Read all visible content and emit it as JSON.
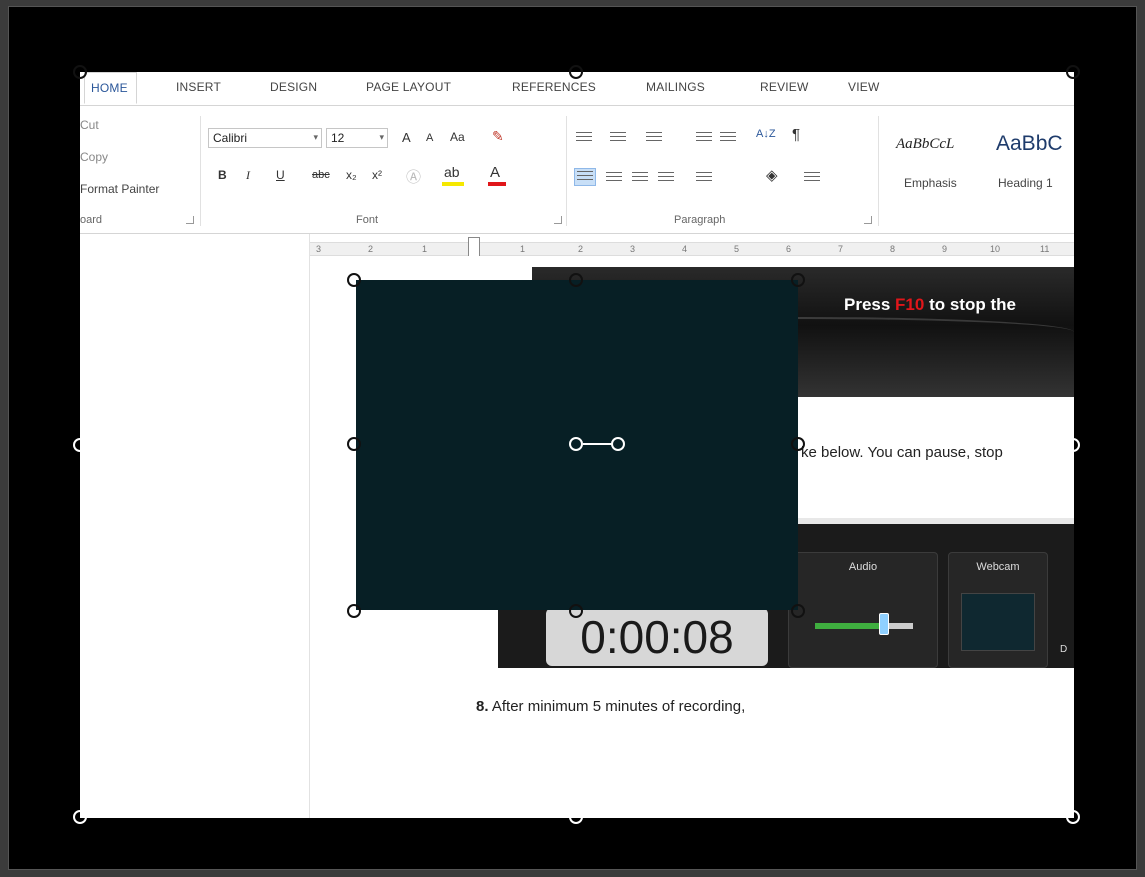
{
  "ribbon": {
    "tabs": [
      "HOME",
      "INSERT",
      "DESIGN",
      "PAGE LAYOUT",
      "REFERENCES",
      "MAILINGS",
      "REVIEW",
      "VIEW"
    ],
    "clipboard": {
      "cut": "Cut",
      "copy": "Copy",
      "format_painter": "Format Painter",
      "group_label": "oard"
    },
    "font": {
      "family": "Calibri",
      "size": "12",
      "group_label": "Font",
      "grow": "A",
      "shrink": "A",
      "case": "Aa",
      "bold": "B",
      "italic": "I",
      "underline": "U",
      "strike": "abc",
      "subscript": "x₂",
      "superscript": "x²"
    },
    "paragraph": {
      "group_label": "Paragraph",
      "pilcrow": "¶",
      "sort": "A↓Z"
    },
    "styles": {
      "emphasis_preview": "AaBbCcL",
      "emphasis_label": "Emphasis",
      "heading_preview": "AaBbC",
      "heading_label": "Heading 1"
    }
  },
  "ruler": {
    "numbers": [
      "3",
      "2",
      "1",
      "1",
      "2",
      "3",
      "4",
      "5",
      "6",
      "7",
      "8",
      "9",
      "10",
      "11"
    ]
  },
  "document": {
    "banner": {
      "press": "Press ",
      "key": "F10",
      "rest": " to stop the"
    },
    "line1": "ke below. You can pause, stop",
    "step_number": "8.",
    "step_text": " After minimum 5 minutes of recording,"
  },
  "recorder": {
    "timer": "0:00:08",
    "audio_label": "Audio",
    "webcam_label": "Webcam",
    "extra_label": "D",
    "audio_level": 0.7
  },
  "colors": {
    "accent": "#2b579a",
    "key_red": "#e0161a",
    "dark_rect": "#071f25"
  }
}
